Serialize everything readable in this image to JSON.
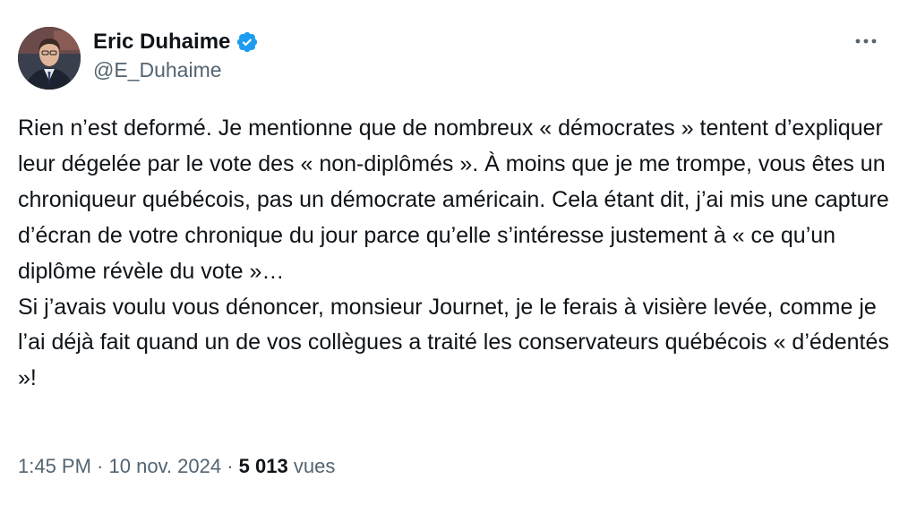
{
  "author": {
    "name": "Eric Duhaime",
    "handle": "@E_Duhaime",
    "verified": true,
    "verified_icon": "verified-badge-icon",
    "verified_color": "#1d9bf0"
  },
  "menu": {
    "icon": "more-icon"
  },
  "tweet": {
    "paragraphs": [
      "Rien n’est deformé. Je mentionne que de nombreux « démocrates » tentent d’expliquer leur dégelée par le vote des « non-diplômés ». À moins que je me trompe, vous êtes un chroniqueur québécois, pas un démocrate américain. Cela étant dit, j’ai mis une capture d’écran de votre chronique du jour parce qu’elle s’intéresse justement à « ce qu’un diplôme révèle du vote »…",
      "Si j’avais voulu vous dénoncer, monsieur Journet, je le ferais à visière levée, comme je l’ai déjà fait quand un de vos collègues a traité les conservateurs québécois « d’édentés »!"
    ]
  },
  "meta": {
    "time": "1:45 PM",
    "separator": " · ",
    "date": "10 nov. 2024",
    "views_count": "5 013",
    "views_label": "vues"
  }
}
